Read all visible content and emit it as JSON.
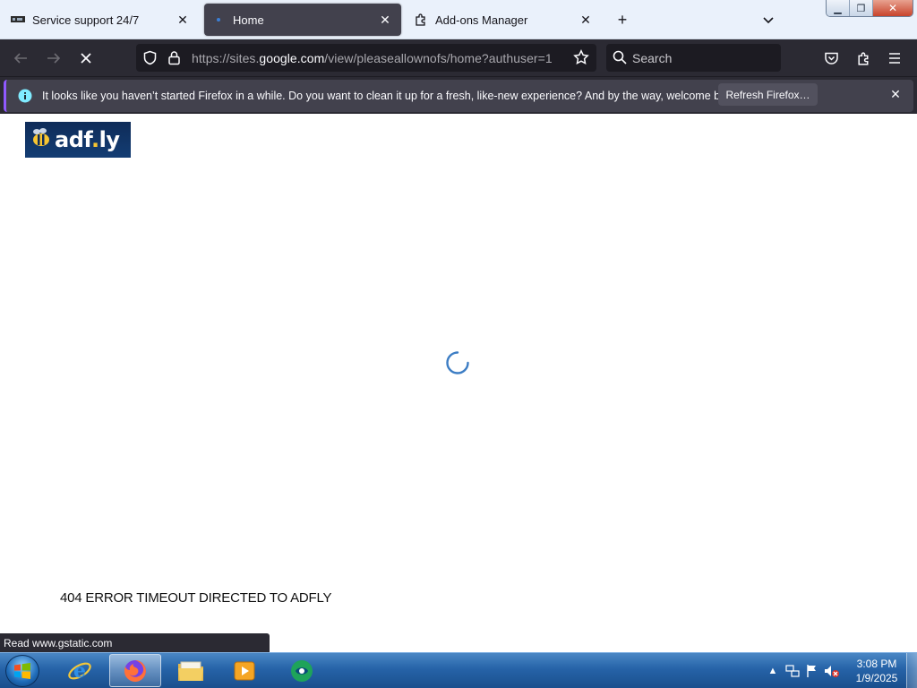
{
  "browser": {
    "tabs": [
      {
        "title": "Service support 24/7",
        "active": false
      },
      {
        "title": "Home",
        "active": true
      },
      {
        "title": "Add-ons Manager",
        "active": false
      }
    ],
    "new_tab_glyph": "+",
    "list_tabs_glyph": "⌄",
    "urlbar": {
      "prefix": "https://sites.",
      "host": "google.com",
      "path": "/view/pleaseallownofs/home?authuser=1"
    },
    "search_placeholder": "Search",
    "notification": {
      "message": "It looks like you haven’t started Firefox in a while. Do you want to clean it up for a fresh, like-new experience? And by the way, welcome back!",
      "button_label": "Refresh Firefox…"
    },
    "status_text": "Read www.gstatic.com"
  },
  "page": {
    "logo_text": "adf",
    "logo_dot": ".",
    "logo_suffix": "ly",
    "error_message": "404 ERROR TIMEOUT DIRECTED TO ADFLY"
  },
  "taskbar": {
    "clock_time": "3:08 PM",
    "clock_date": "1/9/2025",
    "tray_arrow": "▲"
  },
  "colors": {
    "toolbar": "#2b2a33",
    "field": "#1c1b22",
    "accent": "#9059ff",
    "spinner": "#3c7dc4"
  }
}
